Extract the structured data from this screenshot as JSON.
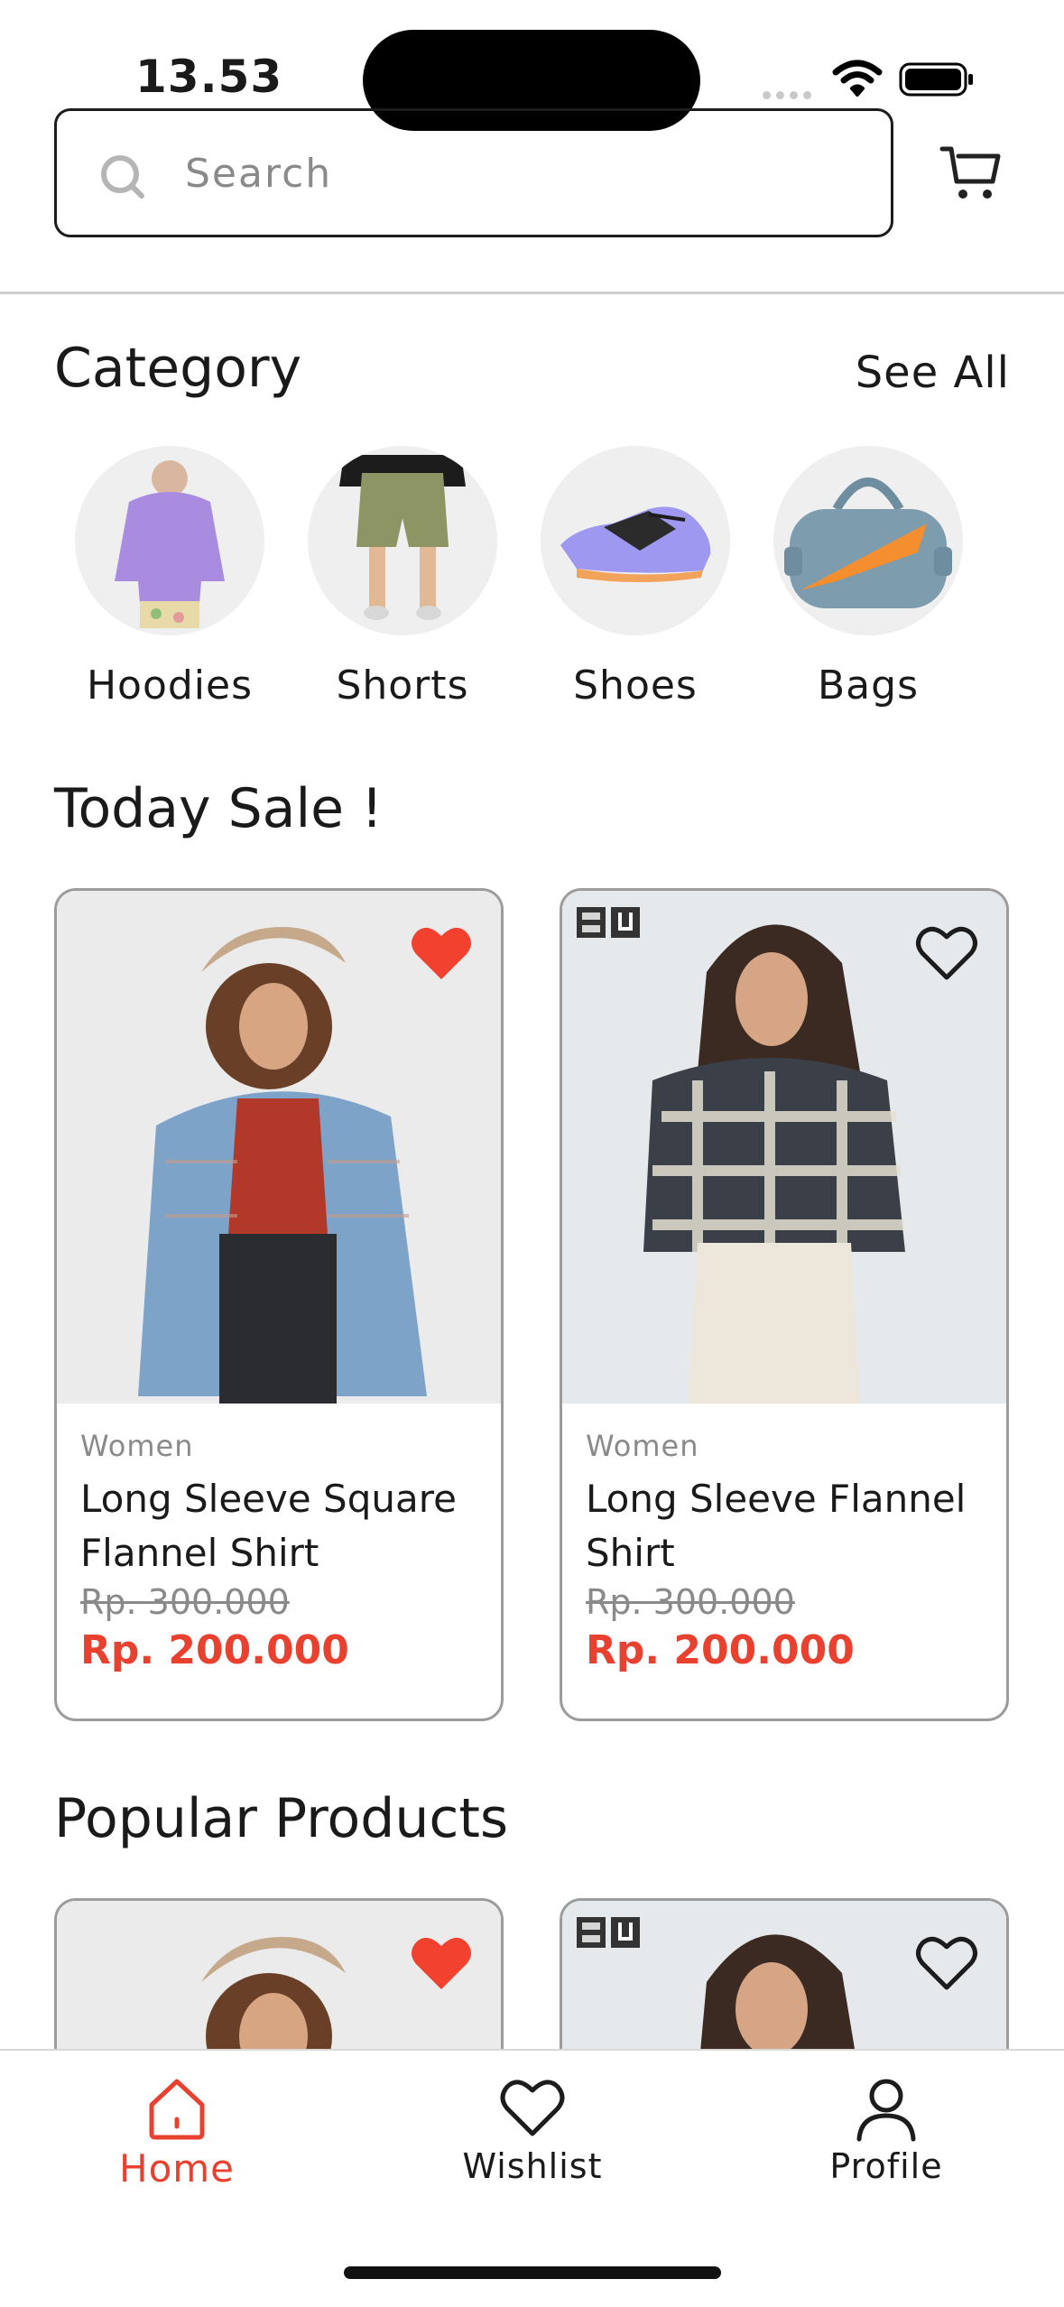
{
  "status_bar": {
    "time": "13.53"
  },
  "search": {
    "placeholder": "Search"
  },
  "category": {
    "title": "Category",
    "see_all": "See All",
    "items": [
      {
        "label": "Hoodies",
        "icon": "hoodie-image"
      },
      {
        "label": "Shorts",
        "icon": "shorts-image"
      },
      {
        "label": "Shoes",
        "icon": "shoe-image"
      },
      {
        "label": "Bags",
        "icon": "bag-image"
      }
    ]
  },
  "today_sale": {
    "title": "Today Sale !",
    "products": [
      {
        "category": "Women",
        "name": "Long Sleeve Square Flannel Shirt",
        "old_price": "Rp. 300.000",
        "price": "Rp. 200.000",
        "favorited": true
      },
      {
        "category": "Women",
        "name": "Long Sleeve Flannel Shirt",
        "old_price": "Rp. 300.000",
        "price": "Rp. 200.000",
        "favorited": false
      }
    ]
  },
  "popular_products": {
    "title": "Popular Products",
    "products": [
      {
        "favorited": true
      },
      {
        "favorited": false
      }
    ]
  },
  "bottom_nav": {
    "items": [
      {
        "label": "Home",
        "icon": "home-icon",
        "active": true
      },
      {
        "label": "Wishlist",
        "icon": "heart-icon",
        "active": false
      },
      {
        "label": "Profile",
        "icon": "user-icon",
        "active": false
      }
    ]
  },
  "colors": {
    "accent": "#e8412f",
    "text": "#1a1a1a",
    "muted": "#8a8a8a",
    "border": "#9c9c9c"
  }
}
